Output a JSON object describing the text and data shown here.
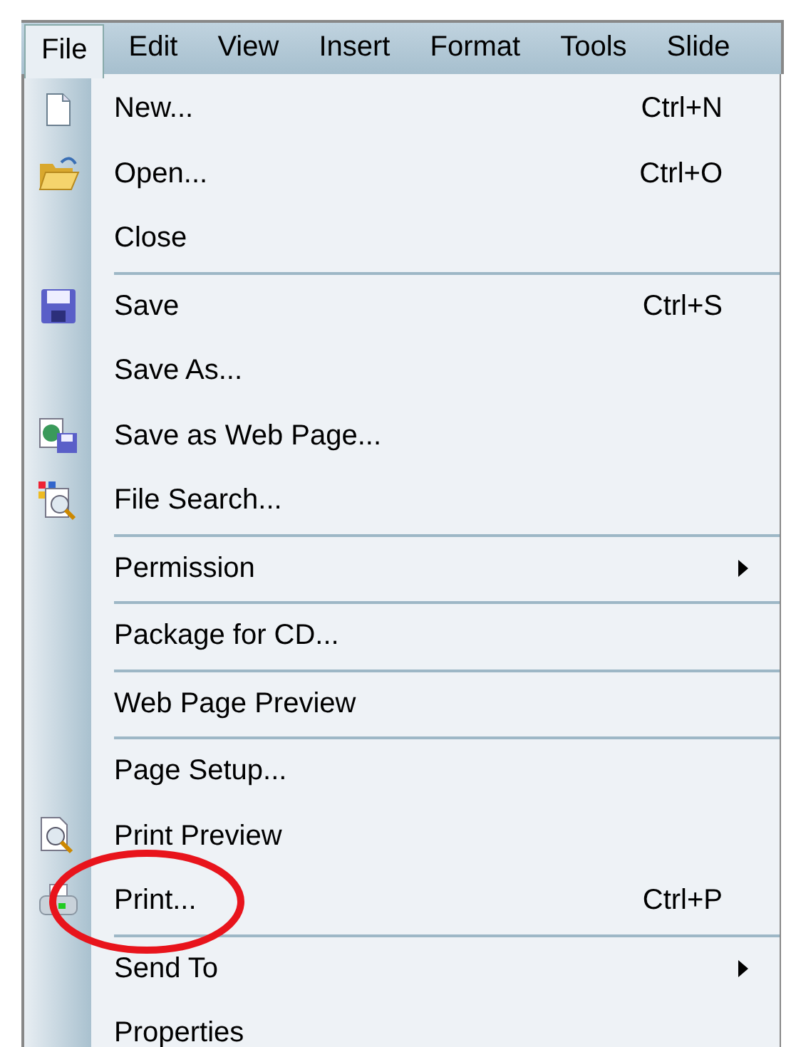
{
  "menu_bar": [
    {
      "label": "File",
      "selected": true
    },
    {
      "label": "Edit",
      "selected": false
    },
    {
      "label": "View",
      "selected": false
    },
    {
      "label": "Insert",
      "selected": false
    },
    {
      "label": "Format",
      "selected": false
    },
    {
      "label": "Tools",
      "selected": false
    },
    {
      "label": "Slide",
      "selected": false
    }
  ],
  "file_menu": {
    "groups": [
      [
        {
          "label": "New...",
          "shortcut": "Ctrl+N",
          "submenu": false,
          "circled": false
        },
        {
          "label": "Open...",
          "shortcut": "Ctrl+O",
          "submenu": false,
          "circled": false
        },
        {
          "label": "Close",
          "submenu": false,
          "circled": false
        }
      ],
      [
        {
          "label": "Save",
          "shortcut": "Ctrl+S",
          "submenu": false,
          "circled": false
        },
        {
          "label": "Save As...",
          "submenu": false,
          "circled": false
        },
        {
          "label": "Save as Web Page...",
          "submenu": false,
          "circled": false
        },
        {
          "label": "File Search...",
          "submenu": false,
          "circled": false
        }
      ],
      [
        {
          "label": "Permission",
          "submenu": true,
          "circled": false
        }
      ],
      [
        {
          "label": "Package for CD...",
          "submenu": false,
          "circled": false
        }
      ],
      [
        {
          "label": "Web Page Preview",
          "submenu": false,
          "circled": false
        }
      ],
      [
        {
          "label": "Page Setup...",
          "submenu": false,
          "circled": false
        },
        {
          "label": "Print Preview",
          "submenu": false,
          "circled": false
        },
        {
          "label": "Print...",
          "shortcut": "Ctrl+P",
          "submenu": false,
          "circled": true
        }
      ],
      [
        {
          "label": "Send To",
          "submenu": true,
          "circled": false
        },
        {
          "label": "Properties",
          "submenu": false,
          "circled": false
        }
      ]
    ]
  }
}
